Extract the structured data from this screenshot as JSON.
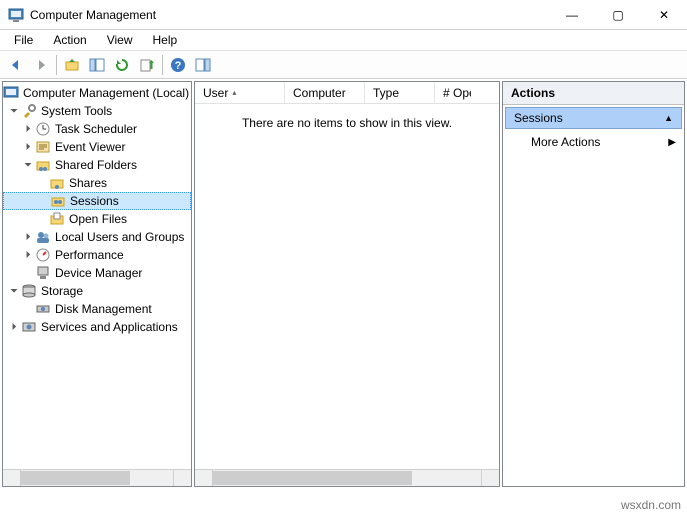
{
  "window": {
    "title": "Computer Management",
    "controls": {
      "min": "—",
      "max": "▢",
      "close": "✕"
    }
  },
  "menus": [
    "File",
    "Action",
    "View",
    "Help"
  ],
  "toolbar_icons": [
    "back",
    "forward",
    "up",
    "show-hide-tree",
    "refresh",
    "export-list",
    "properties",
    "help",
    "show-hide-action"
  ],
  "tree": {
    "root": "Computer Management (Local)",
    "system_tools": "System Tools",
    "task_scheduler": "Task Scheduler",
    "event_viewer": "Event Viewer",
    "shared_folders": "Shared Folders",
    "shares": "Shares",
    "sessions": "Sessions",
    "open_files": "Open Files",
    "local_users": "Local Users and Groups",
    "performance": "Performance",
    "device_manager": "Device Manager",
    "storage": "Storage",
    "disk_management": "Disk Management",
    "services_apps": "Services and Applications"
  },
  "list": {
    "columns": [
      "User",
      "Computer",
      "Type",
      "# Open"
    ],
    "empty_text": "There are no items to show in this view."
  },
  "actions": {
    "header": "Actions",
    "group": "Sessions",
    "more": "More Actions"
  },
  "watermark": "wsxdn.com"
}
